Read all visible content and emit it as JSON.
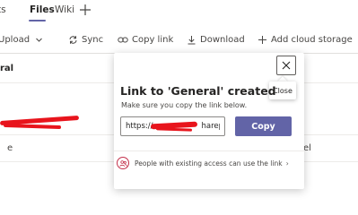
{
  "tabs": {
    "posts": "ts",
    "files": "Files",
    "wiki": "Wiki"
  },
  "toolbar": {
    "upload": "Upload",
    "sync": "Sync",
    "copy_link": "Copy link",
    "download": "Download",
    "add_cloud": "Add cloud storage"
  },
  "background": {
    "heading": "ral",
    "cell_left": "e",
    "cell_right": "el"
  },
  "dialog": {
    "title": "Link to 'General' created",
    "subtitle": "Make sure you copy the link below.",
    "link_value": "https://                    harepoi...",
    "copy_label": "Copy",
    "close_tooltip": "Close",
    "access_text": "People with existing access can use the link",
    "access_chevron": "›"
  },
  "colors": {
    "accent": "#6264a7",
    "redaction": "#e8141c",
    "access_icon": "#c4314b"
  },
  "icons": {
    "add_tab": "plus-icon",
    "upload_chevron": "chevron-down-icon",
    "sync": "sync-icon",
    "copy_link": "link-icon",
    "download": "download-icon",
    "add_cloud": "plus-icon",
    "close": "close-icon",
    "access": "people-icon"
  }
}
